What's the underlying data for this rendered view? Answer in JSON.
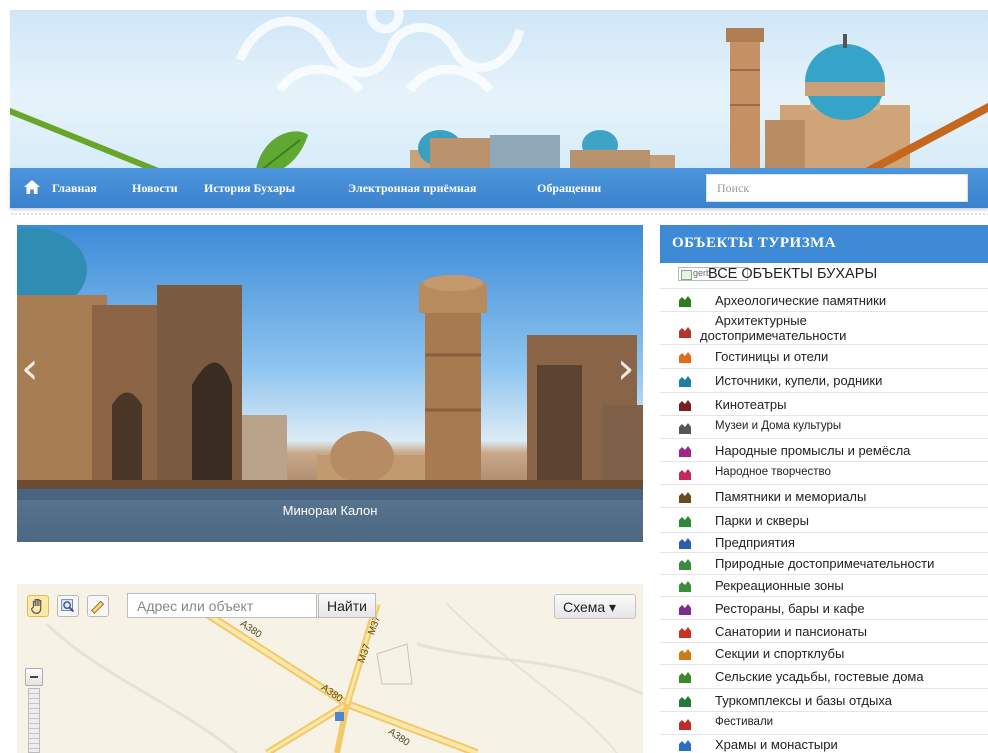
{
  "nav": {
    "home_icon": "home-icon",
    "items": [
      "Главная",
      "Новости",
      "История Бухары",
      "Электронная приёмная",
      "Обращении"
    ],
    "search_placeholder": "Поиск"
  },
  "slider": {
    "caption": "Минораи Калон",
    "prev_icon": "‹",
    "next_icon": "›"
  },
  "map": {
    "search_placeholder": "Адрес или объект",
    "find_label": "Найти",
    "scheme_label": "Схема ▾",
    "road_labels": [
      "A380",
      "M37",
      "M37",
      "A380",
      "A380"
    ]
  },
  "sidebar": {
    "title": "ОБЪЕКТЫ ТУРИЗМА",
    "all_label": "ВСЕ ОБЪЕКТЫ БУХАРЫ",
    "broken_image_alt": "gerb",
    "items": [
      {
        "label": "Археологические памятники",
        "icon": "ruins-icon",
        "color": "#2e7d1e"
      },
      {
        "label": "Архитектурные\nдостопримечательности",
        "icon": "architecture-icon",
        "color": "#b6362a"
      },
      {
        "label": "Гостиницы и отели",
        "icon": "hotel-icon",
        "color": "#e06a1d"
      },
      {
        "label": "Источники, купели, родники",
        "icon": "spring-icon",
        "color": "#1f7fa3"
      },
      {
        "label": "Кинотеатры",
        "icon": "cinema-icon",
        "color": "#7a1f1f"
      },
      {
        "label": "Музеи и Дома культуры",
        "icon": "museum-icon",
        "color": "#555555"
      },
      {
        "label": "Народные промыслы и ремёсла",
        "icon": "crafts-icon",
        "color": "#a0278a"
      },
      {
        "label": "Народное творчество",
        "icon": "folk-art-icon",
        "color": "#c2285a"
      },
      {
        "label": "Памятники и мемориалы",
        "icon": "monument-icon",
        "color": "#6b4a1e"
      },
      {
        "label": "Парки и скверы",
        "icon": "park-icon",
        "color": "#2c8a36"
      },
      {
        "label": "Предприятия",
        "icon": "enterprise-icon",
        "color": "#2a5fb0"
      },
      {
        "label": "Природные достопримечательности",
        "icon": "nature-icon",
        "color": "#3a8d3a"
      },
      {
        "label": "Рекреационные зоны",
        "icon": "recreation-icon",
        "color": "#3b8f3b"
      },
      {
        "label": "Рестораны, бары и кафе",
        "icon": "restaurant-icon",
        "color": "#7c2c8c"
      },
      {
        "label": "Санатории и пансионаты",
        "icon": "sanatorium-icon",
        "color": "#c9331f"
      },
      {
        "label": "Секции и спортклубы",
        "icon": "sport-icon",
        "color": "#d27a18"
      },
      {
        "label": "Сельские усадьбы, гостевые дома",
        "icon": "guesthouse-icon",
        "color": "#3b8a2a"
      },
      {
        "label": "Туркомплексы и базы отдыха",
        "icon": "tourbase-icon",
        "color": "#237a3a"
      },
      {
        "label": "Фестивали",
        "icon": "festival-icon",
        "color": "#c22a2a"
      },
      {
        "label": "Храмы и монастыри",
        "icon": "temple-icon",
        "color": "#2a6fc2"
      }
    ]
  }
}
